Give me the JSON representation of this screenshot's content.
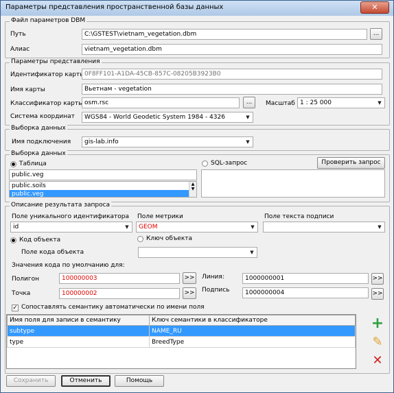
{
  "window": {
    "title": "Параметры представления пространственной базы данных",
    "close_glyph": "✕"
  },
  "dbm": {
    "group": "Файл параметров DBM",
    "path_label": "Путь",
    "path_value": "C:\\GSTEST\\vietnam_vegetation.dbm",
    "browse": "...",
    "alias_label": "Алиас",
    "alias_value": "vietnam_vegetation.dbm"
  },
  "view": {
    "group": "Параметры представления",
    "map_id_label": "Идентификатор карты",
    "map_id_value": "0F8FF101-A1DA-45CB-857C-08205B3923B0",
    "map_name_label": "Имя карты",
    "map_name_value": "Вьетнам - vegetation",
    "classifier_label": "Классификатор карты",
    "classifier_value": "osm.rsc",
    "classifier_browse": "...",
    "scale_label": "Масштаб",
    "scale_value": "1 : 25 000",
    "crs_label": "Система координат",
    "crs_value": "WGS84 - World Geodetic System 1984 - 4326"
  },
  "data_source": {
    "group": "Выборка данных",
    "conn_label": "Имя подключения",
    "conn_value": "gis-lab.info"
  },
  "selection": {
    "group": "Выборка данных",
    "table_radio": "Таблица",
    "sql_radio": "SQL-запрос",
    "check_query": "Проверить запрос",
    "table_value": "public.veg",
    "tables": [
      "public.soils",
      "public.veg"
    ],
    "selected_table": 1
  },
  "result": {
    "group": "Описание результата запроса",
    "uid_label": "Поле уникального идентификатора",
    "uid_value": "id",
    "geom_label": "Поле метрики",
    "geom_value": "GEOM",
    "caption_label": "Поле текста подписи",
    "caption_value": "",
    "obj_code_radio": "Код объекта",
    "obj_key_radio": "Ключ объекта",
    "code_field_label": "Поле кода объекта",
    "code_field_value": "",
    "defaults_label": "Значения кода по умолчанию для:",
    "polygon_label": "Полигон",
    "polygon_value": "100000003",
    "point_label": "Точка",
    "point_value": "100000002",
    "line_label": "Линия:",
    "line_value": "1000000001",
    "caption2_label": "Подпись",
    "caption2_value": "1000000004",
    "arrow": ">>",
    "auto_match_label": "Сопоставлять семантику автоматически по имени поля",
    "auto_match_checked": true
  },
  "semantics": {
    "col_field": "Имя поля для записи в семантику",
    "col_key": "Ключ семантики в классификаторе",
    "rows": [
      {
        "field": "subtype",
        "key": "NAME_RU"
      },
      {
        "field": "type",
        "key": "BreedType"
      }
    ],
    "selected_row": 0,
    "add_icon": "+",
    "edit_icon": "✎",
    "delete_icon": "✕"
  },
  "footer": {
    "save": "Сохранить",
    "cancel": "Отменить",
    "help": "Помощь"
  },
  "colors": {
    "selection": "#3399ff",
    "code_red": "#dd0000",
    "add_green": "#2ea043",
    "delete_red": "#d12020",
    "edit_orange": "#e0a030"
  }
}
